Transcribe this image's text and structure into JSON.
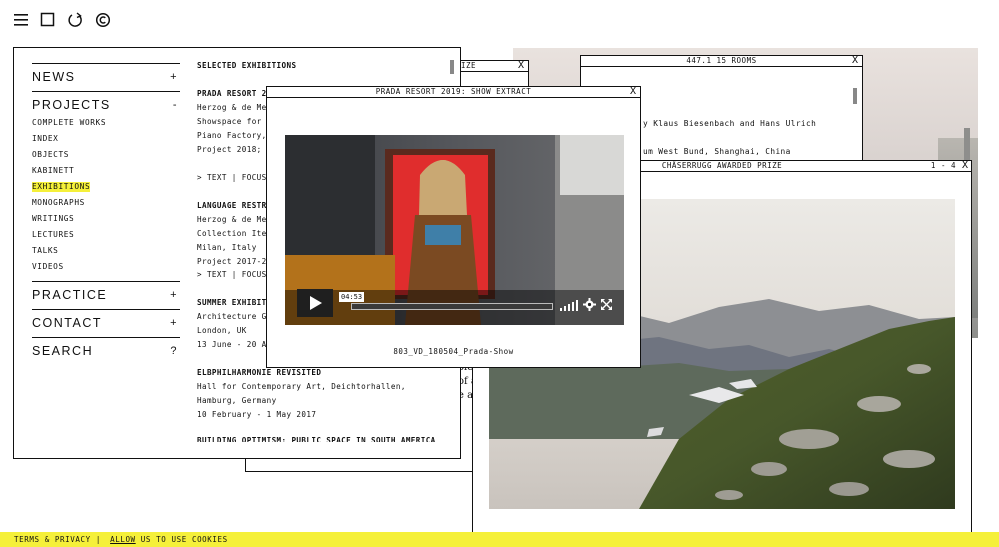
{
  "top_icons": [
    "hamburger-icon",
    "square-icon",
    "refresh-icon",
    "copyright-icon"
  ],
  "menu": {
    "news": {
      "label": "NEWS",
      "sign": "+"
    },
    "projects": {
      "label": "PROJECTS",
      "sign": "-",
      "items": [
        "COMPLETE WORKS",
        "INDEX",
        "OBJECTS",
        "KABINETT",
        "EXHIBITIONS",
        "MONOGRAPHS",
        "WRITINGS",
        "LECTURES",
        "TALKS",
        "VIDEOS"
      ],
      "active": "EXHIBITIONS"
    },
    "practice": {
      "label": "PRACTICE",
      "sign": "+"
    },
    "contact": {
      "label": "CONTACT",
      "sign": "+"
    },
    "search": {
      "label": "SEARCH",
      "sign": "?"
    }
  },
  "exhibitions": {
    "heading": "SELECTED EXHIBITIONS",
    "lines": [
      {
        "text": "PRADA RESORT 20",
        "bold": true
      },
      {
        "text": "Herzog & de Meu",
        "bold": false
      },
      {
        "text": "Showspace for P",
        "bold": false
      },
      {
        "text": "Piano Factory,",
        "bold": false
      },
      {
        "text": "Project 2018; S",
        "bold": false
      },
      {
        "text": "> TEXT | FOCUS",
        "bold": false
      },
      {
        "text": "LANGUAGE RESTRA",
        "bold": true
      },
      {
        "text": "Herzog & de Meu",
        "bold": false
      },
      {
        "text": "Collection Item",
        "bold": false
      },
      {
        "text": "Milan, Italy",
        "bold": false
      },
      {
        "text": "Project 2017-20",
        "bold": false
      },
      {
        "text": "> TEXT | FOCUS",
        "bold": false
      },
      {
        "text": "SUMMER EXHIBITI",
        "bold": true
      },
      {
        "text": "Architecture Ga",
        "bold": false
      },
      {
        "text": "London, UK",
        "bold": false
      },
      {
        "text": "13 June - 20 Au",
        "bold": false
      },
      {
        "text": "ELBPHILHARMONIE REVISITED",
        "bold": true
      },
      {
        "text": "Hall for Contemporary Art, Deichtorhallen,",
        "bold": false
      },
      {
        "text": "Hamburg, Germany",
        "bold": false
      },
      {
        "text": "10 February - 1 May 2017",
        "bold": false
      },
      {
        "text": "BUILDING OPTIMISM: PUBLIC SPACE IN SOUTH AMERICA",
        "bold": true
      }
    ]
  },
  "windows": {
    "prize_back": {
      "title": "PRIZE",
      "close": "X"
    },
    "rooms": {
      "title": "447.1 15 ROOMS",
      "close": "X",
      "lines": [
        "y Klaus Biesenbach and Hans Ulrich",
        "um West Bund, Shanghai, China"
      ]
    },
    "video": {
      "title": "PRADA RESORT 2019: SHOW EXTRACT",
      "close": "X",
      "time": "04:53",
      "progress": 0.0,
      "caption": "803_VD_180504_Prada-Show"
    },
    "chaserrugg": {
      "title": "CHÄSERRUGG AWARDED PRIZE",
      "counter": "1 - 4",
      "close": "X"
    },
    "partial_text": [
      "ole",
      "of a",
      "e a"
    ]
  },
  "cookie": {
    "prefix": "TERMS & PRIVACY  |",
    "allow": "ALLOW",
    "suffix": "US TO USE COOKIES"
  }
}
